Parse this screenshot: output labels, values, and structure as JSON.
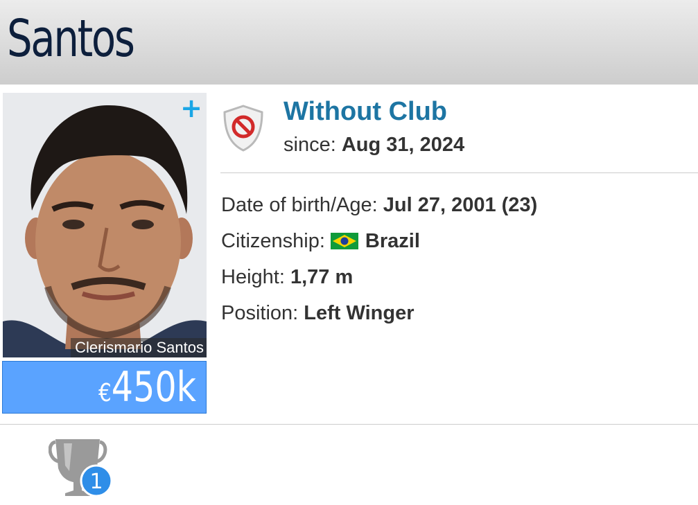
{
  "header": {
    "player_name": "Santos"
  },
  "photo": {
    "caption": "Clerismario Santos",
    "add_label": "+"
  },
  "market_value": {
    "currency": "€",
    "amount": "450k"
  },
  "club": {
    "name": "Without Club",
    "since_label": "since:",
    "since_value": "Aug 31, 2024",
    "icon": "no-club-shield-icon"
  },
  "info": [
    {
      "label": "Date of birth/Age:",
      "value": "Jul 27, 2001 (23)"
    },
    {
      "label": "Citizenship:",
      "value": "Brazil",
      "flag": "brazil-flag-icon"
    },
    {
      "label": "Height:",
      "value": "1,77 m"
    },
    {
      "label": "Position:",
      "value": "Left Winger"
    }
  ],
  "achievements": {
    "icon": "trophy-icon",
    "count": "1"
  },
  "colors": {
    "accent_blue": "#1d75a3",
    "value_box": "#5aa3ff",
    "badge_blue": "#2f8ee8"
  }
}
